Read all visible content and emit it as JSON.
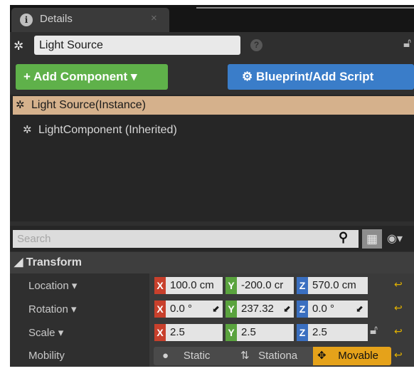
{
  "tab": {
    "title": "Details",
    "close": "×",
    "icon": "info-icon"
  },
  "actor": {
    "name": "Light Source",
    "help": "?"
  },
  "buttons": {
    "add_component": "+ Add Component ▾",
    "blueprint": "Blueprint/Add Script",
    "blueprint_icon": "⚙"
  },
  "components": [
    {
      "label": "Light Source(Instance)",
      "selected": true
    },
    {
      "label": "LightComponent (Inherited)",
      "selected": false
    }
  ],
  "search": {
    "placeholder": "Search"
  },
  "transform": {
    "header": "◢ Transform",
    "location": {
      "label": "Location ▾",
      "x": "100.0 cm",
      "y": "-200.0 cr",
      "z": "570.0 cm"
    },
    "rotation": {
      "label": "Rotation ▾",
      "x": "0.0 °",
      "y": "237.32",
      "z": "0.0 °"
    },
    "scale": {
      "label": "Scale ▾",
      "x": "2.5",
      "y": "2.5",
      "z": "2.5"
    },
    "mobility": {
      "label": "Mobility",
      "options": [
        "Static",
        "Stationa",
        "Movable"
      ],
      "selected": "Movable"
    }
  },
  "axis_labels": {
    "x": "X",
    "y": "Y",
    "z": "Z"
  },
  "colors": {
    "selected_row": "#d5b18c",
    "add_button": "#5fb14a",
    "blueprint_button": "#3a7dc9",
    "movable": "#e5a21a"
  }
}
